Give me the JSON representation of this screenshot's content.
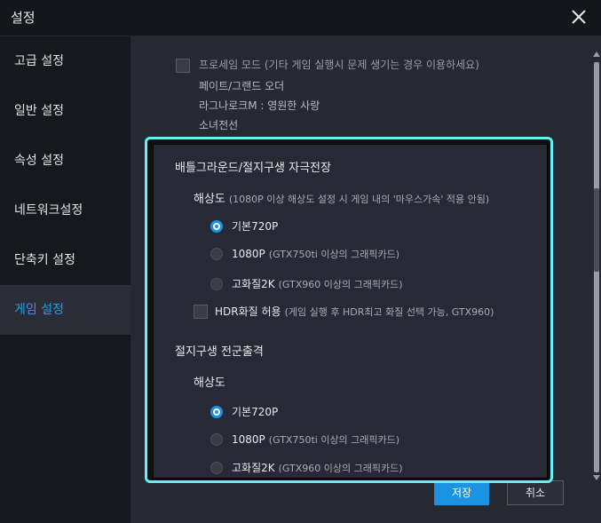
{
  "window": {
    "title": "설정"
  },
  "sidebar": {
    "items": [
      {
        "label": "고급 설정"
      },
      {
        "label": "일반 설정"
      },
      {
        "label": "속성 설정"
      },
      {
        "label": "네트워크설정"
      },
      {
        "label": "단축키 설정"
      },
      {
        "label": "게임 설정",
        "active": true
      }
    ]
  },
  "top_section": {
    "checkbox_label": "프로세임 모드 (기타 게임 실행시 문제 생기는 경우 이용하세요)",
    "games": [
      "페이트/그랜드 오더",
      "라그나로크M : 영원한 사랑",
      "소녀전선"
    ]
  },
  "section1": {
    "title": "배틀그라운드/절지구생 자극전장",
    "resolution_label": "해상도",
    "resolution_hint": "(1080P 이상 해상도 설정 시 게임 내의 '마우스가속' 적용 안됨)",
    "options": [
      {
        "label": "기본720P",
        "hint": "",
        "selected": true
      },
      {
        "label": "1080P",
        "hint": "(GTX750ti 이상의 그래픽카드)",
        "selected": false
      },
      {
        "label": "고화질2K",
        "hint": "(GTX960 이상의 그래픽카드)",
        "selected": false
      }
    ],
    "hdr_label": "HDR화질 허용",
    "hdr_hint": "(게임 실행 후 HDR최고 화질 선택 가능, GTX960)"
  },
  "section2": {
    "title": "절지구생 전군출격",
    "resolution_label": "해상도",
    "options": [
      {
        "label": "기본720P",
        "hint": "",
        "selected": true
      },
      {
        "label": "1080P",
        "hint": "(GTX750ti 이상의 그래픽카드)",
        "selected": false
      },
      {
        "label": "고화질2K",
        "hint": "(GTX960 이상의 그래픽카드)",
        "selected": false
      }
    ]
  },
  "buttons": {
    "save": "저장",
    "cancel": "취소"
  },
  "colors": {
    "accent": "#1c93e0",
    "highlight": "#66f0f5",
    "active_nav_text": "#1ca2e4"
  }
}
